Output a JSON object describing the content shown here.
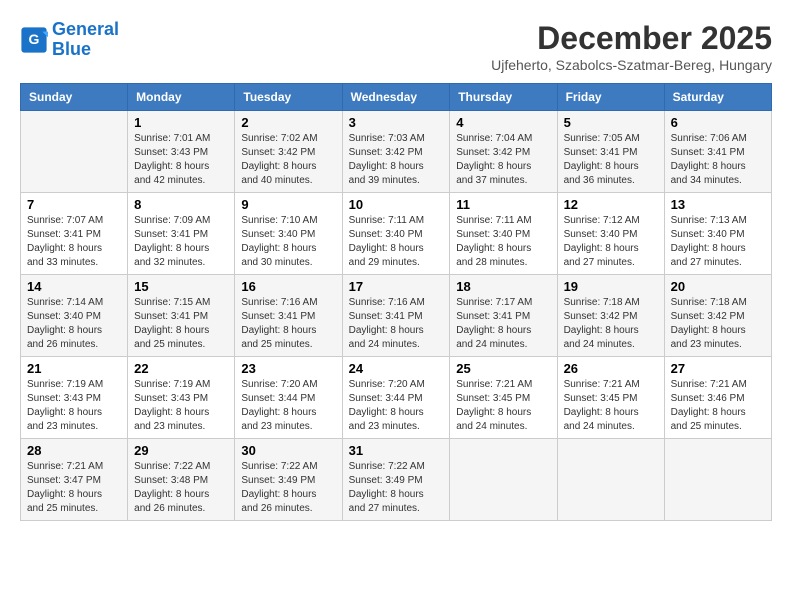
{
  "logo": {
    "line1": "General",
    "line2": "Blue"
  },
  "title": "December 2025",
  "subtitle": "Ujfeherto, Szabolcs-Szatmar-Bereg, Hungary",
  "headers": [
    "Sunday",
    "Monday",
    "Tuesday",
    "Wednesday",
    "Thursday",
    "Friday",
    "Saturday"
  ],
  "weeks": [
    [
      {
        "day": "",
        "info": ""
      },
      {
        "day": "1",
        "info": "Sunrise: 7:01 AM\nSunset: 3:43 PM\nDaylight: 8 hours\nand 42 minutes."
      },
      {
        "day": "2",
        "info": "Sunrise: 7:02 AM\nSunset: 3:42 PM\nDaylight: 8 hours\nand 40 minutes."
      },
      {
        "day": "3",
        "info": "Sunrise: 7:03 AM\nSunset: 3:42 PM\nDaylight: 8 hours\nand 39 minutes."
      },
      {
        "day": "4",
        "info": "Sunrise: 7:04 AM\nSunset: 3:42 PM\nDaylight: 8 hours\nand 37 minutes."
      },
      {
        "day": "5",
        "info": "Sunrise: 7:05 AM\nSunset: 3:41 PM\nDaylight: 8 hours\nand 36 minutes."
      },
      {
        "day": "6",
        "info": "Sunrise: 7:06 AM\nSunset: 3:41 PM\nDaylight: 8 hours\nand 34 minutes."
      }
    ],
    [
      {
        "day": "7",
        "info": "Sunrise: 7:07 AM\nSunset: 3:41 PM\nDaylight: 8 hours\nand 33 minutes."
      },
      {
        "day": "8",
        "info": "Sunrise: 7:09 AM\nSunset: 3:41 PM\nDaylight: 8 hours\nand 32 minutes."
      },
      {
        "day": "9",
        "info": "Sunrise: 7:10 AM\nSunset: 3:40 PM\nDaylight: 8 hours\nand 30 minutes."
      },
      {
        "day": "10",
        "info": "Sunrise: 7:11 AM\nSunset: 3:40 PM\nDaylight: 8 hours\nand 29 minutes."
      },
      {
        "day": "11",
        "info": "Sunrise: 7:11 AM\nSunset: 3:40 PM\nDaylight: 8 hours\nand 28 minutes."
      },
      {
        "day": "12",
        "info": "Sunrise: 7:12 AM\nSunset: 3:40 PM\nDaylight: 8 hours\nand 27 minutes."
      },
      {
        "day": "13",
        "info": "Sunrise: 7:13 AM\nSunset: 3:40 PM\nDaylight: 8 hours\nand 27 minutes."
      }
    ],
    [
      {
        "day": "14",
        "info": "Sunrise: 7:14 AM\nSunset: 3:40 PM\nDaylight: 8 hours\nand 26 minutes."
      },
      {
        "day": "15",
        "info": "Sunrise: 7:15 AM\nSunset: 3:41 PM\nDaylight: 8 hours\nand 25 minutes."
      },
      {
        "day": "16",
        "info": "Sunrise: 7:16 AM\nSunset: 3:41 PM\nDaylight: 8 hours\nand 25 minutes."
      },
      {
        "day": "17",
        "info": "Sunrise: 7:16 AM\nSunset: 3:41 PM\nDaylight: 8 hours\nand 24 minutes."
      },
      {
        "day": "18",
        "info": "Sunrise: 7:17 AM\nSunset: 3:41 PM\nDaylight: 8 hours\nand 24 minutes."
      },
      {
        "day": "19",
        "info": "Sunrise: 7:18 AM\nSunset: 3:42 PM\nDaylight: 8 hours\nand 24 minutes."
      },
      {
        "day": "20",
        "info": "Sunrise: 7:18 AM\nSunset: 3:42 PM\nDaylight: 8 hours\nand 23 minutes."
      }
    ],
    [
      {
        "day": "21",
        "info": "Sunrise: 7:19 AM\nSunset: 3:43 PM\nDaylight: 8 hours\nand 23 minutes."
      },
      {
        "day": "22",
        "info": "Sunrise: 7:19 AM\nSunset: 3:43 PM\nDaylight: 8 hours\nand 23 minutes."
      },
      {
        "day": "23",
        "info": "Sunrise: 7:20 AM\nSunset: 3:44 PM\nDaylight: 8 hours\nand 23 minutes."
      },
      {
        "day": "24",
        "info": "Sunrise: 7:20 AM\nSunset: 3:44 PM\nDaylight: 8 hours\nand 23 minutes."
      },
      {
        "day": "25",
        "info": "Sunrise: 7:21 AM\nSunset: 3:45 PM\nDaylight: 8 hours\nand 24 minutes."
      },
      {
        "day": "26",
        "info": "Sunrise: 7:21 AM\nSunset: 3:45 PM\nDaylight: 8 hours\nand 24 minutes."
      },
      {
        "day": "27",
        "info": "Sunrise: 7:21 AM\nSunset: 3:46 PM\nDaylight: 8 hours\nand 25 minutes."
      }
    ],
    [
      {
        "day": "28",
        "info": "Sunrise: 7:21 AM\nSunset: 3:47 PM\nDaylight: 8 hours\nand 25 minutes."
      },
      {
        "day": "29",
        "info": "Sunrise: 7:22 AM\nSunset: 3:48 PM\nDaylight: 8 hours\nand 26 minutes."
      },
      {
        "day": "30",
        "info": "Sunrise: 7:22 AM\nSunset: 3:49 PM\nDaylight: 8 hours\nand 26 minutes."
      },
      {
        "day": "31",
        "info": "Sunrise: 7:22 AM\nSunset: 3:49 PM\nDaylight: 8 hours\nand 27 minutes."
      },
      {
        "day": "",
        "info": ""
      },
      {
        "day": "",
        "info": ""
      },
      {
        "day": "",
        "info": ""
      }
    ]
  ]
}
